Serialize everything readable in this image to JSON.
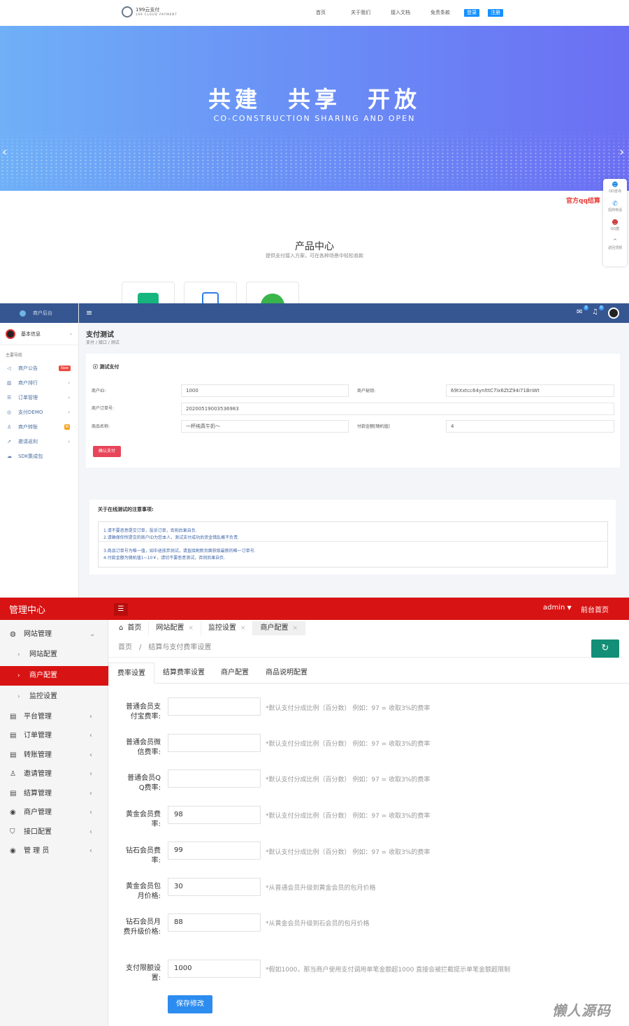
{
  "site": {
    "logo_text": "199云支付",
    "logo_sub": "199 CLOUD PAYMENT",
    "nav": [
      "首页",
      "关于我们",
      "接入文档",
      "免责条款"
    ],
    "login_label": "登录",
    "register_label": "注册",
    "banner_title": "共建　共享　开放",
    "banner_sub": "CO-CONSTRUCTION SHARING AND OPEN",
    "float_items": [
      "QQ咨询",
      "招商电话",
      "QQ群",
      "返回顶部"
    ],
    "qq_red_text": "官方qq结算",
    "product_title": "产品中心",
    "product_sub": "提供支付接入方案，可在各种场景中轻松收款",
    "accent": "#1890ff"
  },
  "merchant": {
    "brand": "商户后台",
    "user": "基本信息",
    "nav_head": "主要导航",
    "items": [
      {
        "label": "商户公告",
        "icon": "volume-icon",
        "badge": "New"
      },
      {
        "label": "商户排行",
        "icon": "bar-chart-icon",
        "caret": "‹"
      },
      {
        "label": "订单管理",
        "icon": "list-icon",
        "caret": "‹"
      },
      {
        "label": "支付DEMO",
        "icon": "coin-icon",
        "caret": "‹"
      },
      {
        "label": "商户转账",
        "icon": "user-icon",
        "badge": "M"
      },
      {
        "label": "邀请返利",
        "icon": "share-icon",
        "caret": "‹"
      },
      {
        "label": "SDK集成包",
        "icon": "cloud-icon"
      }
    ],
    "topbar_badges": [
      "3",
      "0"
    ],
    "page_title": "支付测试",
    "crumb": "支付 / 接口 / 测试",
    "panel_title": "测试支付",
    "form": {
      "merchant_id_label": "商户ID:",
      "merchant_id": "1000",
      "merchant_key_label": "商户秘钥:",
      "merchant_key": "69tXxtcc64ynlttC7lx6ZtZ94i71BnWt",
      "order_label": "商户订单号:",
      "order_no": "20200519003536983",
      "goods_label": "商品名称:",
      "goods_name": "一杯纯真牛奶～",
      "amount_label": "付款金额[随机值]",
      "amount": "4",
      "confirm_label": "确认支付"
    },
    "note_title": "关于在线测试的注意事项:",
    "notes_a": [
      "1.请不要恶意提交订单，投诉订单，否则后果自负.",
      "2.请确保你所提交的商户ID为您本人，测试支付成功后资金错乱概不负责."
    ],
    "notes_b": [
      "3.商品订单号为唯一值，如中途放弃测试，请直接刷新页面获取最新的唯一订单号.",
      "4.付款金额为随机值1~10￥，请切不要恶意测试，否则后果自负."
    ]
  },
  "admin": {
    "brand": "管理中心",
    "user": "admin",
    "front_link": "前台首页",
    "menu": [
      {
        "label": "网站管理",
        "icon": "globe-icon",
        "caret": "⌄"
      },
      {
        "label": "平台管理",
        "icon": "doc-icon",
        "caret": "‹"
      },
      {
        "label": "订单管理",
        "icon": "doc-icon",
        "caret": "‹"
      },
      {
        "label": "转账管理",
        "icon": "doc-icon",
        "caret": "‹"
      },
      {
        "label": "邀请管理",
        "icon": "user-icon",
        "caret": "‹"
      },
      {
        "label": "结算管理",
        "icon": "doc-icon",
        "caret": "‹"
      },
      {
        "label": "商户管理",
        "icon": "person-circle-icon",
        "caret": "‹"
      },
      {
        "label": "接口配置",
        "icon": "shield-icon",
        "caret": "‹"
      },
      {
        "label": "管 理 员",
        "icon": "person-circle-icon",
        "caret": "‹"
      }
    ],
    "submenu": [
      "网站配置",
      "商户配置",
      "监控设置"
    ],
    "tabs": [
      "首页",
      "网站配置",
      "监控设置",
      "商户配置"
    ],
    "crumb": "首页　/　结算与支付费率设置",
    "subtabs": [
      "费率设置",
      "结算费率设置",
      "商户配置",
      "商品说明配置"
    ],
    "rows": [
      {
        "label": "普通会员支付宝费率:",
        "value": "",
        "hint": "*默认支付分成比例（百分数） 例如：97 = 收取3%的费率"
      },
      {
        "label": "普通会员微信费率:",
        "value": "",
        "hint": "*默认支付分成比例（百分数） 例如：97 = 收取3%的费率"
      },
      {
        "label": "普通会员Q Q费率:",
        "value": "",
        "hint": "*默认支付分成比例（百分数） 例如：97 = 收取3%的费率"
      },
      {
        "label": "黄金会员费率:",
        "value": "98",
        "hint": "*默认支付分成比例（百分数） 例如：97 = 收取3%的费率"
      },
      {
        "label": "钻石会员费率:",
        "value": "99",
        "hint": "*默认支付分成比例（百分数） 例如：97 = 收取3%的费率"
      },
      {
        "label": "黄金会员包月价格:",
        "value": "30",
        "hint": "*从普通会员升级到黄金会员的包月价格"
      },
      {
        "label": "钻石会员月费升级价格:",
        "value": "88",
        "hint": "*从黄金会员升级到石会员的包月价格"
      },
      {
        "label": "支付限额设置:",
        "value": "1000",
        "hint": "*假如1000，那当商户使用支付调用单笔金额超1000 直接会被拦截提示单笔金额超限制"
      }
    ],
    "save_label": "保存修改",
    "accent": "#d81313"
  },
  "watermark": "懒人源码"
}
